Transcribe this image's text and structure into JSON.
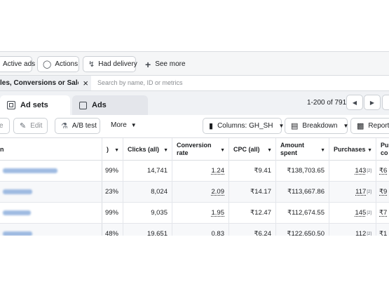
{
  "filter_bar": {
    "chips": [
      {
        "label": "Active ads",
        "icon": "none"
      },
      {
        "label": "Actions",
        "icon": "lightbulb-icon"
      },
      {
        "label": "Had delivery",
        "icon": "bolt-icon"
      }
    ],
    "see_more": "See more"
  },
  "search_bar": {
    "active_filter": "les, Conversions or Sales",
    "placeholder": "Search by name, ID or metrics"
  },
  "tabs": {
    "ad_sets": "Ad sets",
    "ads": "Ads"
  },
  "pagination": {
    "label": "1-200 of 791"
  },
  "toolbar": {
    "edit": "Edit",
    "ab_test": "A/B test",
    "more": "More",
    "columns": "Columns: GH_SH",
    "breakdown": "Breakdown",
    "reports": "Reports"
  },
  "table": {
    "headers": {
      "name": "n",
      "prev": ")",
      "clicks": "Clicks (all)",
      "conversion_rate": "Conversion rate",
      "cpc": "CPC (all)",
      "amount_spent": "Amount spent",
      "purchases": "Purchases",
      "next": "Pu co"
    },
    "rows": [
      {
        "prev": "99%",
        "clicks": "14,741",
        "conversion_rate": "1.24",
        "cpc": "₹9.41",
        "amount_spent": "₹138,703.65",
        "purchases": "143",
        "next": "₹6"
      },
      {
        "prev": "23%",
        "clicks": "8,024",
        "conversion_rate": "2.09",
        "cpc": "₹14.17",
        "amount_spent": "₹113,667.86",
        "purchases": "117",
        "next": "₹9"
      },
      {
        "prev": "99%",
        "clicks": "9,035",
        "conversion_rate": "1.95",
        "cpc": "₹12.47",
        "amount_spent": "₹112,674.55",
        "purchases": "145",
        "next": "₹7"
      },
      {
        "prev": "48%",
        "clicks": "19,651",
        "conversion_rate": "0.83",
        "cpc": "₹6.24",
        "amount_spent": "₹122,650.50",
        "purchases": "112",
        "next": "₹1"
      }
    ],
    "purchase_sup": "[2]"
  }
}
